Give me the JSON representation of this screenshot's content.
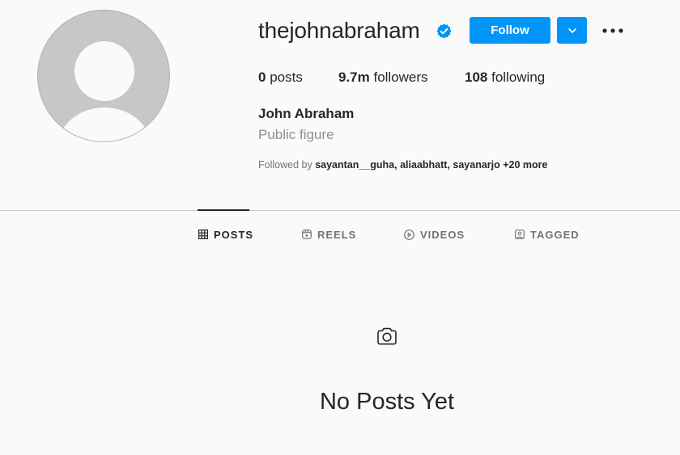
{
  "profile": {
    "username": "thejohnabraham",
    "verified": true,
    "follow_label": "Follow",
    "full_name": "John Abraham",
    "category": "Public figure",
    "stats": {
      "posts_count": "0",
      "posts_label": " posts",
      "followers_count": "9.7m",
      "followers_label": " followers",
      "following_count": "108",
      "following_label": " following"
    },
    "followed_by": {
      "prefix": "Followed by ",
      "names": "sayantan__guha, aliaabhatt, sayanarjo",
      "suffix": " +20 more"
    }
  },
  "tabs": [
    {
      "label": "POSTS",
      "icon": "grid-icon",
      "active": true
    },
    {
      "label": "REELS",
      "icon": "reels-icon",
      "active": false
    },
    {
      "label": "VIDEOS",
      "icon": "play-circle-icon",
      "active": false
    },
    {
      "label": "TAGGED",
      "icon": "tagged-icon",
      "active": false
    }
  ],
  "empty_state": {
    "icon": "camera-icon",
    "text": "No Posts Yet"
  },
  "colors": {
    "accent": "#0095f6",
    "background": "#fafafa",
    "text": "#262626",
    "muted": "#8e8e8e"
  }
}
